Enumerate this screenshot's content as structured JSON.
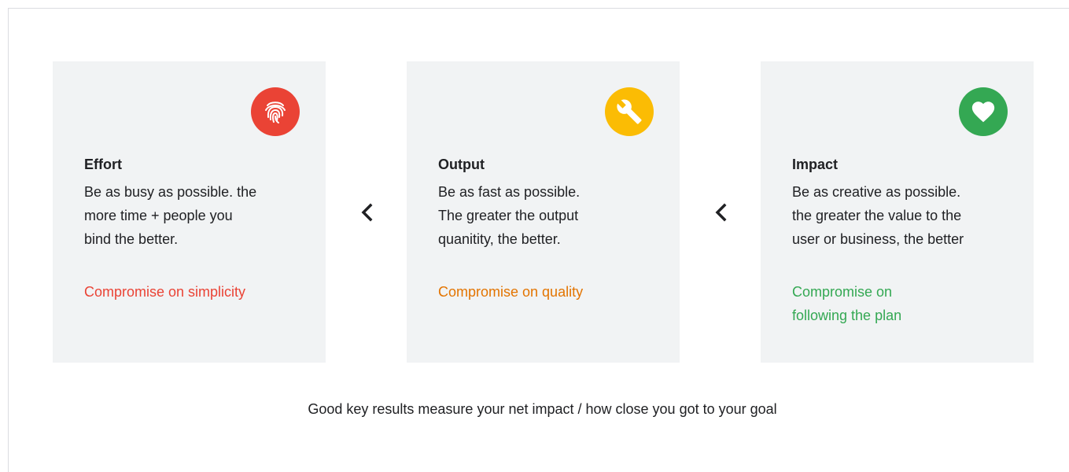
{
  "cards": [
    {
      "title": "Effort",
      "lines": [
        "Be as busy as possible. the",
        "more time + people you",
        "bind the better."
      ],
      "compromise": [
        "Compromise on simplicity"
      ],
      "icon": "fingerprint-icon",
      "color": "#ea4335",
      "text_color": "#ea4335"
    },
    {
      "title": "Output",
      "lines": [
        "Be as fast as possible.",
        "The greater the output",
        "quanitity, the better."
      ],
      "compromise": [
        "Compromise on quality"
      ],
      "icon": "wrench-icon",
      "color": "#fbbc04",
      "text_color": "#e37400"
    },
    {
      "title": "Impact",
      "lines": [
        "Be as creative as possible.",
        "the greater the value to the",
        "user or business, the better"
      ],
      "compromise": [
        "Compromise on",
        "following the plan"
      ],
      "icon": "heart-icon",
      "color": "#34a853",
      "text_color": "#34a853"
    }
  ],
  "arrows": [
    "chevron-left-icon",
    "chevron-left-icon"
  ],
  "caption": "Good key results measure your net impact / how close you got to your goal"
}
